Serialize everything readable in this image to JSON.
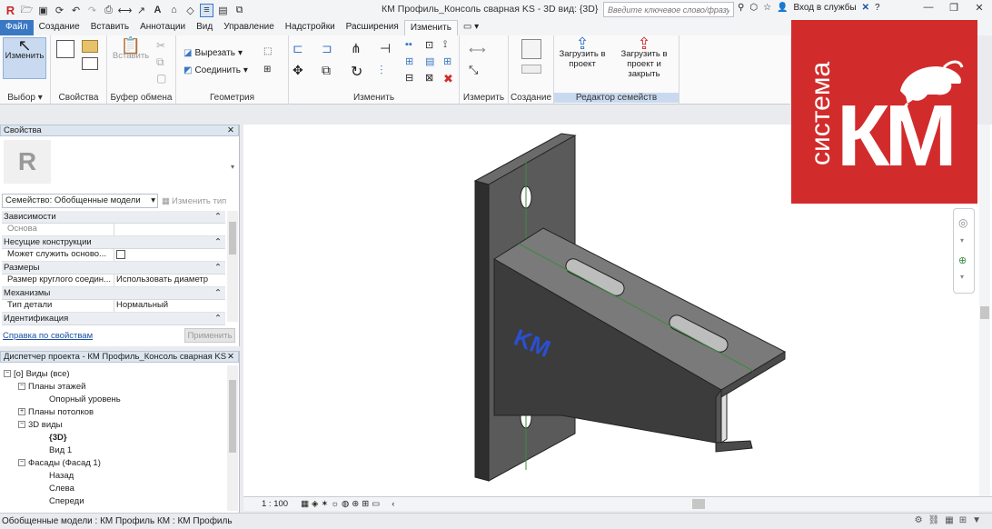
{
  "window": {
    "title": "КМ Профиль_Консоль сварная KS - 3D вид: {3D}"
  },
  "search": {
    "placeholder": "Введите ключевое слово/фразу"
  },
  "account": {
    "sign_in": "Вход в службы"
  },
  "tabs": [
    {
      "label": "Файл"
    },
    {
      "label": "Создание"
    },
    {
      "label": "Вставить"
    },
    {
      "label": "Аннотации"
    },
    {
      "label": "Вид"
    },
    {
      "label": "Управление"
    },
    {
      "label": "Надстройки"
    },
    {
      "label": "Расширения"
    },
    {
      "label": "Изменить"
    }
  ],
  "ribbon": {
    "select": {
      "button": "Изменить",
      "label": "Выбор ▾"
    },
    "properties": {
      "label": "Свойства"
    },
    "clipboard": {
      "paste": "Вставить",
      "label": "Буфер обмена"
    },
    "geometry": {
      "cut": "Вырезать",
      "join": "Соединить",
      "label": "Геометрия"
    },
    "modify": {
      "label": "Изменить"
    },
    "measure": {
      "label": "Измерить"
    },
    "create": {
      "label": "Создание"
    },
    "family_editor": {
      "load": "Загрузить в проект",
      "load_close": "Загрузить в проект и закрыть",
      "label": "Редактор семейств"
    }
  },
  "properties": {
    "title": "Свойства",
    "family": "Семейство: Обобщенные модели",
    "edit_type": "Изменить тип",
    "groups": [
      {
        "name": "Зависимости",
        "rows": [
          {
            "k": "Основа",
            "v": ""
          }
        ]
      },
      {
        "name": "Несущие конструкции",
        "rows": [
          {
            "k": "Может служить осново...",
            "v": ""
          }
        ]
      },
      {
        "name": "Размеры",
        "rows": [
          {
            "k": "Размер круглого соедин...",
            "v": "Использовать диаметр"
          }
        ]
      },
      {
        "name": "Механизмы",
        "rows": [
          {
            "k": "Тип детали",
            "v": "Нормальный"
          }
        ]
      },
      {
        "name": "Идентификация",
        "rows": []
      }
    ],
    "help_link": "Справка по свойствам",
    "apply": "Применить"
  },
  "browser": {
    "title": "Диспетчер проекта - КМ Профиль_Консоль сварная KS",
    "nodes": [
      {
        "label": "Виды (все)",
        "level": 0,
        "toggle": "−"
      },
      {
        "label": "Планы этажей",
        "level": 1,
        "toggle": "−"
      },
      {
        "label": "Опорный уровень",
        "level": 2,
        "toggle": ""
      },
      {
        "label": "Планы потолков",
        "level": 1,
        "toggle": "+"
      },
      {
        "label": "3D виды",
        "level": 1,
        "toggle": "−"
      },
      {
        "label": "{3D}",
        "level": 2,
        "toggle": "",
        "bold": true
      },
      {
        "label": "Вид 1",
        "level": 2,
        "toggle": ""
      },
      {
        "label": "Фасады (Фасад 1)",
        "level": 1,
        "toggle": "−"
      },
      {
        "label": "Назад",
        "level": 2,
        "toggle": ""
      },
      {
        "label": "Слева",
        "level": 2,
        "toggle": ""
      },
      {
        "label": "Спереди",
        "level": 2,
        "toggle": ""
      }
    ]
  },
  "viewbar": {
    "scale": "1 : 100"
  },
  "status": {
    "text": "Обобщенные модели : КМ Профиль КМ : КМ Профиль"
  },
  "model": {
    "emboss": "KM"
  },
  "logo": {
    "word": "система",
    "mark": "КМ",
    "bg": "#d22b2b"
  },
  "colors": {
    "file_tab": "#3a78c3",
    "panel_head": "#dde5ef"
  }
}
